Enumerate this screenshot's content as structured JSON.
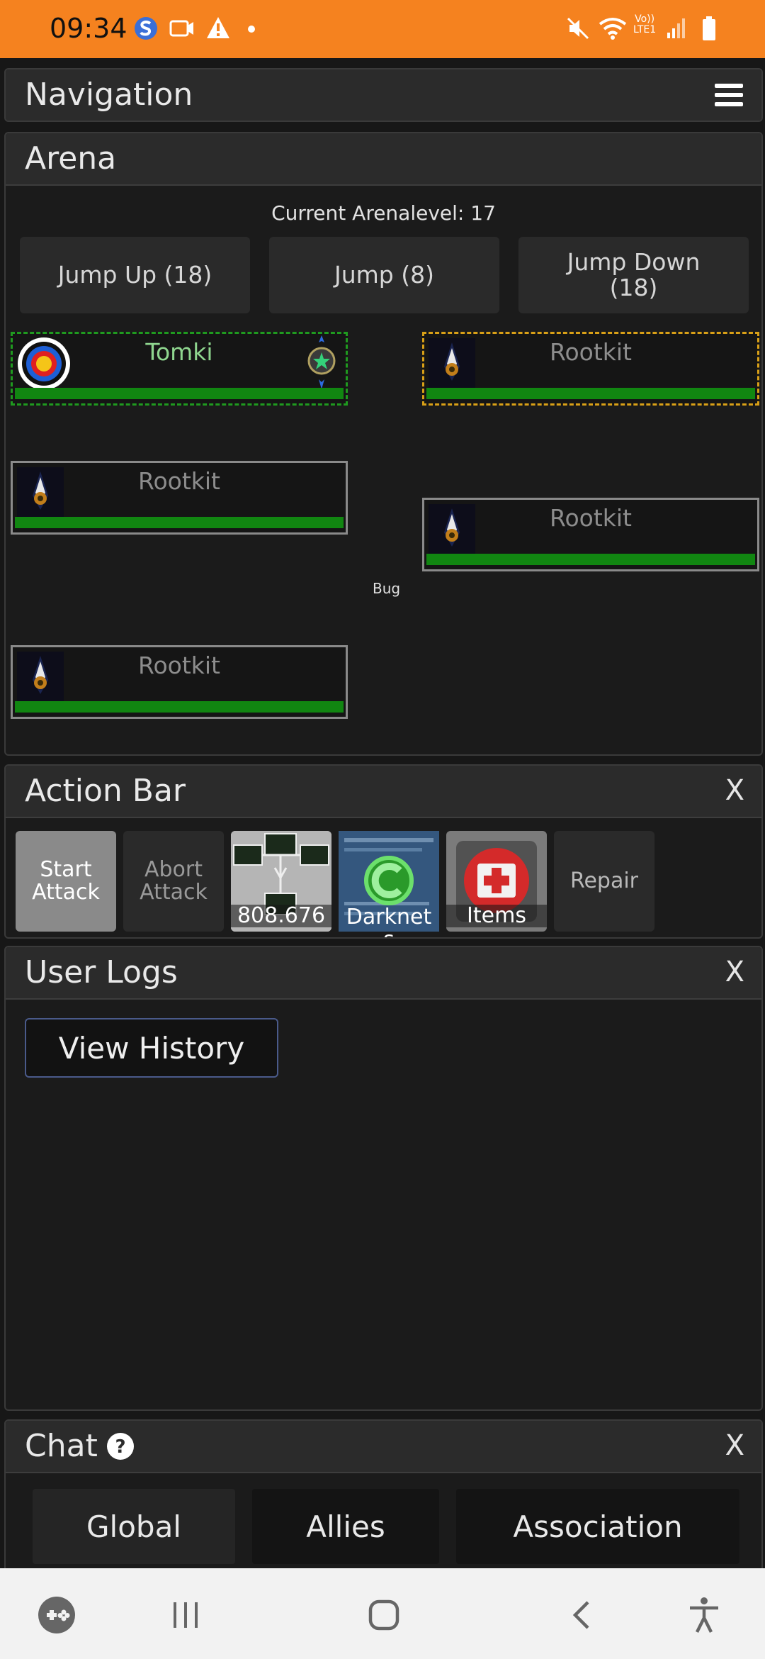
{
  "status_bar": {
    "time": "09:34",
    "signal_text_top": "Vo))",
    "signal_text_bottom": "LTE1",
    "background": "#f5821f"
  },
  "navigation": {
    "title": "Navigation",
    "menu_icon": "hamburger-icon"
  },
  "arena": {
    "title": "Arena",
    "level_text": "Current Arenalevel: 17",
    "jump_buttons": {
      "up": "Jump Up (18)",
      "jump": "Jump (8)",
      "down": "Jump Down (18)"
    },
    "fighters": [
      {
        "name": "Tomki",
        "hp_percent": 100,
        "role": "self"
      },
      {
        "name": "Rootkit",
        "hp_percent": 100,
        "role": "target"
      },
      {
        "name": "Rootkit",
        "hp_percent": 100,
        "role": "enemy"
      },
      {
        "name": "Rootkit",
        "hp_percent": 100,
        "role": "enemy"
      },
      {
        "name": "Rootkit",
        "hp_percent": 100,
        "role": "enemy"
      }
    ],
    "bug_label": "Bug"
  },
  "action_bar": {
    "title": "Action Bar",
    "close_label": "X",
    "start_attack": "Start Attack",
    "abort_attack": "Abort Attack",
    "network_value": "808.676",
    "darknets_label": "Darknets",
    "items_label": "Items",
    "repair_label": "Repair"
  },
  "user_logs": {
    "title": "User Logs",
    "close_label": "X",
    "view_history": "View History"
  },
  "chat": {
    "title": "Chat",
    "help_icon": "question-circle-icon",
    "close_label": "X",
    "tabs": [
      "Global",
      "Allies",
      "Association"
    ]
  },
  "colors": {
    "hp_green": "#118611",
    "self_border": "#1f9a1f",
    "target_border": "#d9a017",
    "self_name": "#8fd68f"
  }
}
